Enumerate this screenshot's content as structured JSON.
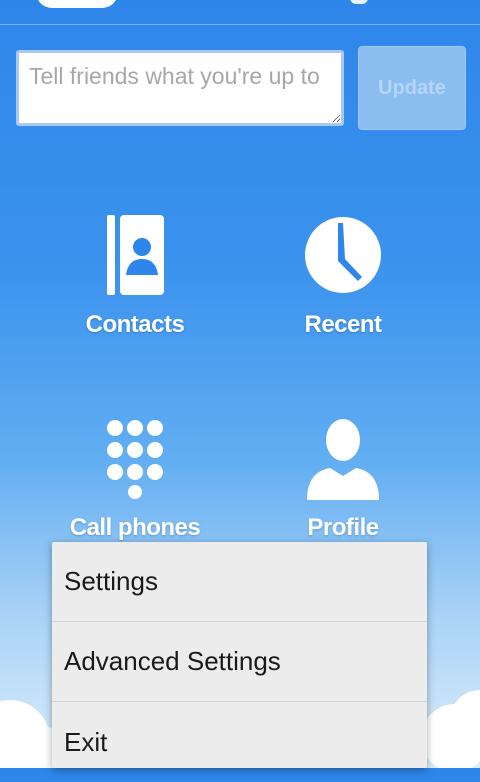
{
  "status": {
    "placeholder": "Tell friends what you're up to",
    "update_label": "Update"
  },
  "grid": {
    "contacts_label": "Contacts",
    "recent_label": "Recent",
    "call_phones_label": "Call phones",
    "profile_label": "Profile"
  },
  "menu": {
    "items": [
      {
        "label": "Settings"
      },
      {
        "label": "Advanced Settings"
      },
      {
        "label": "Exit"
      }
    ]
  },
  "colors": {
    "background_top": "#2f86ea",
    "background_bottom": "#dbeefb",
    "menu_background": "#ececec"
  }
}
